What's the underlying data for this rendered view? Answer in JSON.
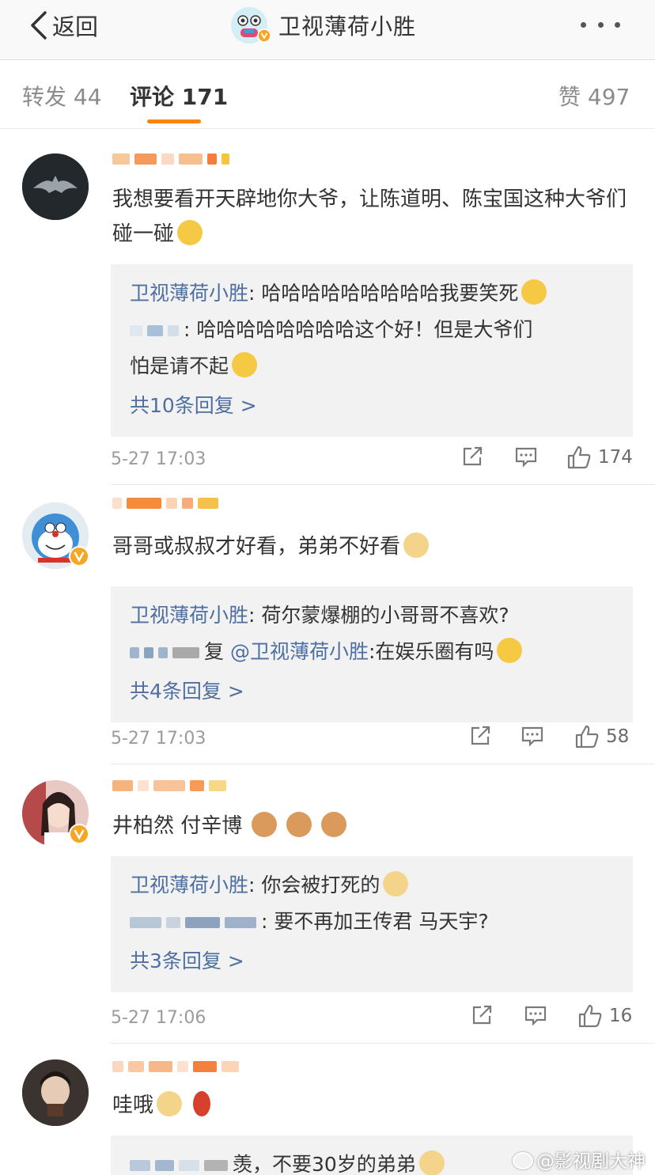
{
  "nav": {
    "back_label": "返回",
    "title": "卫视薄荷小胜",
    "more_icon": "more-icon"
  },
  "tabs": {
    "repost_label": "转发",
    "repost_count": "44",
    "comment_label": "评论",
    "comment_count": "171",
    "like_label": "赞",
    "like_count": "497",
    "accent": "#ff8200"
  },
  "comments": [
    {
      "text": "我想要看开天辟地你大爷，让陈道明、陈宝国这种大爷们碰一碰",
      "emoji": "smirk-emoji",
      "replies": [
        {
          "name": "卫视薄荷小胜",
          "sep": ": ",
          "text": "哈哈哈哈哈哈哈哈哈我要笑死",
          "emoji": "laugh-cry-emoji"
        },
        {
          "name": "",
          "sep": ": ",
          "text": "哈哈哈哈哈哈哈哈这个好！但是大爷们",
          "text2": "怕是请不起",
          "emoji": "rofl-emoji"
        }
      ],
      "reply_total": "共10条回复 >",
      "time": "5-27 17:03",
      "likes": "174"
    },
    {
      "text": "哥哥或叔叔才好看，弟弟不好看",
      "emoji": "doge-emoji",
      "replies": [
        {
          "name": "卫视薄荷小胜",
          "sep": ": ",
          "text": "荷尔蒙爆棚的小哥哥不喜欢?"
        },
        {
          "prefix": "复 ",
          "mention": "@卫视薄荷小胜",
          "text": ":在娱乐圈有吗",
          "emoji": "shush-emoji"
        }
      ],
      "reply_total": "共4条回复 >",
      "time": "5-27 17:03",
      "likes": "58"
    },
    {
      "text": "井柏然 付辛博",
      "emoji": "cat-emoji",
      "replies": [
        {
          "name": "卫视薄荷小胜",
          "sep": ": ",
          "text": "你会被打死的",
          "emoji": "doge-emoji"
        },
        {
          "name": "",
          "sep": ": ",
          "text": "要不再加王传君 马天宇?"
        }
      ],
      "reply_total": "共3条回复 >",
      "time": "5-27 17:06",
      "likes": "16"
    },
    {
      "text": "哇哦",
      "emoji": "doge-emoji",
      "replies": [
        {
          "text": "羡，不要30岁的弟弟"
        }
      ]
    }
  ],
  "watermark": "@影视剧大神",
  "colors": {
    "link": "#4e6fa0",
    "reply_bg": "#f2f2f2",
    "verified": "#f5a623"
  }
}
